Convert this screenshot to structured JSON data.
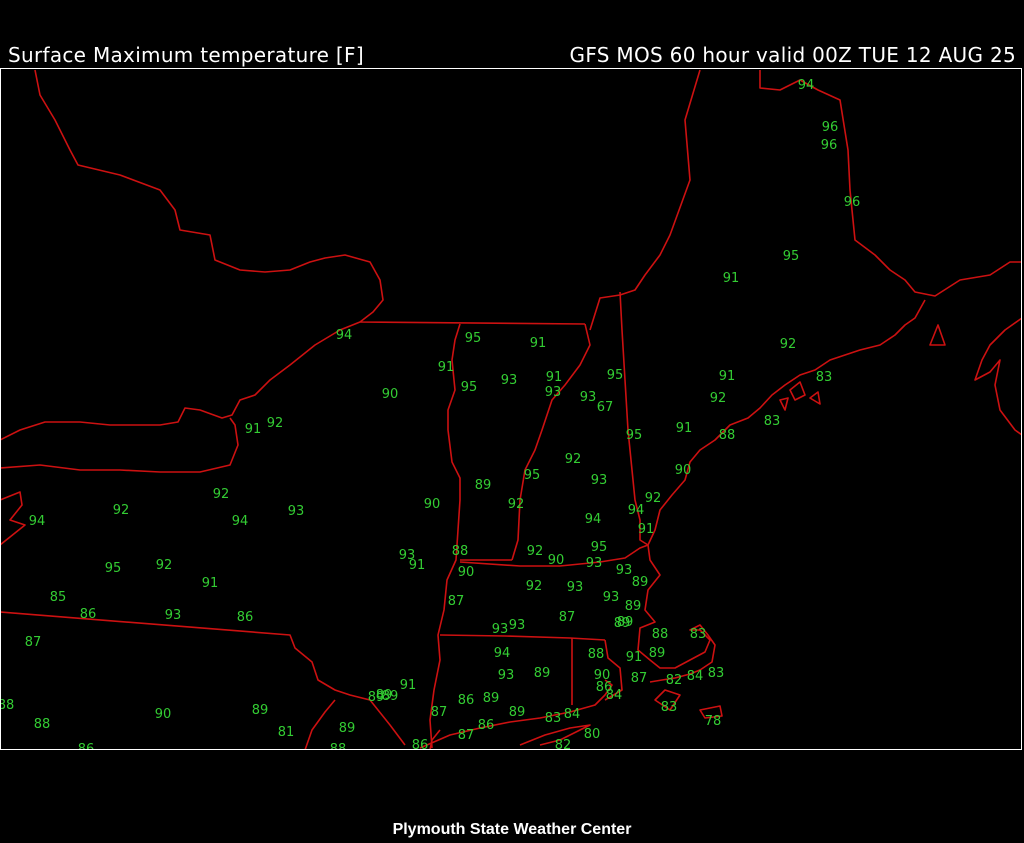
{
  "header": {
    "left_title": "Surface Maximum temperature [F]",
    "right_title": "GFS MOS 60 hour valid 00Z TUE 12 AUG 25"
  },
  "footer": {
    "credit": "Plymouth State Weather Center"
  },
  "colors": {
    "background": "#000000",
    "text": "#ffffff",
    "borders": "#cc1111",
    "values": "#33cc33"
  },
  "stations": [
    {
      "value": "94"
    },
    {
      "value": "96"
    },
    {
      "value": "96"
    },
    {
      "value": "96"
    },
    {
      "value": "95"
    },
    {
      "value": "91"
    },
    {
      "value": "95"
    },
    {
      "value": "91"
    },
    {
      "value": "94"
    },
    {
      "value": "92"
    },
    {
      "value": "91"
    },
    {
      "value": "95"
    },
    {
      "value": "91"
    },
    {
      "value": "93"
    },
    {
      "value": "91"
    },
    {
      "value": "95"
    },
    {
      "value": "93"
    },
    {
      "value": "93"
    },
    {
      "value": "90"
    },
    {
      "value": "67"
    },
    {
      "value": "92"
    },
    {
      "value": "83"
    },
    {
      "value": "91"
    },
    {
      "value": "92"
    },
    {
      "value": "88"
    },
    {
      "value": "83"
    },
    {
      "value": "91"
    },
    {
      "value": "95"
    },
    {
      "value": "92"
    },
    {
      "value": "93"
    },
    {
      "value": "95"
    },
    {
      "value": "89"
    },
    {
      "value": "90"
    },
    {
      "value": "92"
    },
    {
      "value": "92"
    },
    {
      "value": "94"
    },
    {
      "value": "94"
    },
    {
      "value": "91"
    },
    {
      "value": "90"
    },
    {
      "value": "93"
    },
    {
      "value": "92"
    },
    {
      "value": "94"
    },
    {
      "value": "92"
    },
    {
      "value": "94"
    },
    {
      "value": "95"
    },
    {
      "value": "88"
    },
    {
      "value": "93"
    },
    {
      "value": "92"
    },
    {
      "value": "90"
    },
    {
      "value": "93"
    },
    {
      "value": "91"
    },
    {
      "value": "93"
    },
    {
      "value": "95"
    },
    {
      "value": "92"
    },
    {
      "value": "90"
    },
    {
      "value": "89"
    },
    {
      "value": "92"
    },
    {
      "value": "93"
    },
    {
      "value": "93"
    },
    {
      "value": "91"
    },
    {
      "value": "85"
    },
    {
      "value": "86"
    },
    {
      "value": "93"
    },
    {
      "value": "86"
    },
    {
      "value": "87"
    },
    {
      "value": "87"
    },
    {
      "value": "89"
    },
    {
      "value": "93"
    },
    {
      "value": "93"
    },
    {
      "value": "89"
    },
    {
      "value": "87"
    },
    {
      "value": "89"
    },
    {
      "value": "88"
    },
    {
      "value": "83"
    },
    {
      "value": "94"
    },
    {
      "value": "88"
    },
    {
      "value": "91"
    },
    {
      "value": "89"
    },
    {
      "value": "93"
    },
    {
      "value": "89"
    },
    {
      "value": "87"
    },
    {
      "value": "82"
    },
    {
      "value": "84"
    },
    {
      "value": "83"
    },
    {
      "value": "90"
    },
    {
      "value": "86"
    },
    {
      "value": "84"
    },
    {
      "value": "83"
    },
    {
      "value": "89"
    },
    {
      "value": "89"
    },
    {
      "value": "91"
    },
    {
      "value": "88"
    },
    {
      "value": "88"
    },
    {
      "value": "90"
    },
    {
      "value": "89"
    },
    {
      "value": "81"
    },
    {
      "value": "86"
    },
    {
      "value": "86"
    },
    {
      "value": "89"
    },
    {
      "value": "89"
    },
    {
      "value": "88"
    },
    {
      "value": "87"
    },
    {
      "value": "86"
    },
    {
      "value": "86"
    },
    {
      "value": "89"
    },
    {
      "value": "83"
    },
    {
      "value": "84"
    },
    {
      "value": "80"
    },
    {
      "value": "82"
    },
    {
      "value": "78"
    },
    {
      "value": "87"
    },
    {
      "value": "89"
    }
  ]
}
